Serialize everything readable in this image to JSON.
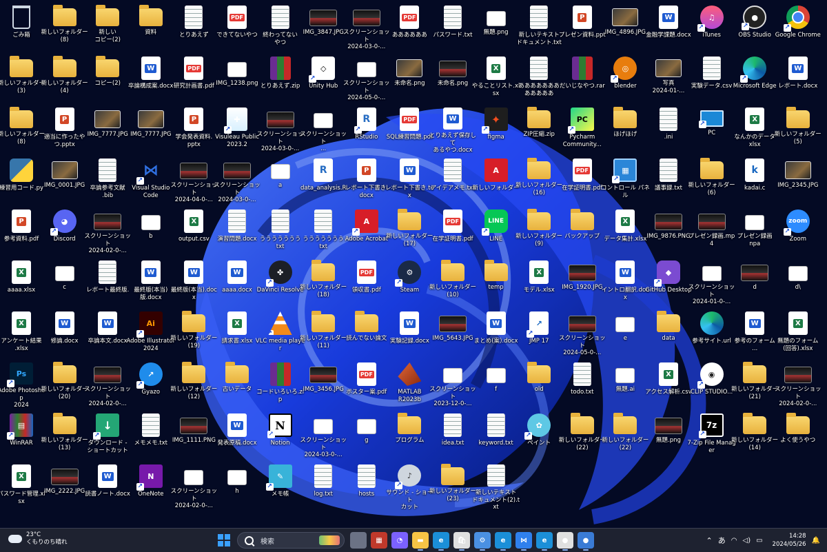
{
  "desktop": {
    "icons": [
      [
        "ごみ箱",
        "bin",
        "recycle-bin-icon",
        false
      ],
      [
        "新しいフォルダー\n(8)",
        "folder",
        "folder-icon",
        false
      ],
      [
        "新しい\nコピー(2)",
        "folder",
        "folder-icon",
        false
      ],
      [
        "資料",
        "folder",
        "folder-icon",
        false
      ],
      [
        "とりあえず",
        "txt",
        "text-file-icon",
        false
      ],
      [
        "できてないやつ",
        "pdf",
        "pdf-file-icon",
        false
      ],
      [
        "終わってない\nやつ",
        "txt",
        "text-file-icon",
        false
      ],
      [
        "IMG_3847.JPG",
        "shot",
        "image-file-icon",
        false
      ],
      [
        "スクリーンショット\n2024-03-0-...",
        "shot",
        "screenshot-file-icon",
        false
      ],
      [
        "ああああああ",
        "pdf",
        "pdf-file-icon",
        false
      ],
      [
        "パスワード.txt",
        "txt",
        "text-file-icon",
        false
      ],
      [
        "無題.png",
        "white",
        "image-file-icon",
        false
      ],
      [
        "新しいテキスト\nドキュメント.txt",
        "txt",
        "text-file-icon",
        false
      ],
      [
        "プレゼン資料.ppt",
        "ppt",
        "powerpoint-file-icon",
        false
      ],
      [
        "IMG_4896.JPG",
        "img",
        "image-file-icon",
        false
      ],
      [
        "金融学課題.docx",
        "word",
        "word-file-icon",
        false
      ],
      [
        "iTunes",
        "itunes",
        "itunes-icon",
        true
      ],
      [
        "OBS Studio",
        "obs",
        "obs-studio-icon",
        true
      ],
      [
        "Google Chrome",
        "chrome",
        "chrome-icon",
        true
      ],
      [
        "新しいフォルダー\n(3)",
        "folder",
        "folder-icon",
        false
      ],
      [
        "新しいフォルダー\n(4)",
        "folder",
        "folder-icon",
        false
      ],
      [
        "コピー(2)",
        "folder",
        "folder-icon",
        false
      ],
      [
        "卒論構成案.docx",
        "word",
        "word-file-icon",
        false
      ],
      [
        "研究計画書.pdf",
        "pdf",
        "pdf-file-icon",
        false
      ],
      [
        "IMG_1238.png",
        "white",
        "image-file-icon",
        false
      ],
      [
        "とりあえず.zip",
        "zip",
        "zip-file-icon",
        false
      ],
      [
        "Unity Hub",
        "unity",
        "unity-hub-icon",
        true
      ],
      [
        "スクリーンショット\n2024-05-0-...",
        "white",
        "screenshot-file-icon",
        false
      ],
      [
        "未命名.png",
        "img",
        "image-file-icon",
        false
      ],
      [
        "未命名.png",
        "shot",
        "image-file-icon",
        false
      ],
      [
        "やることリスト.xlsx",
        "excel",
        "excel-file-icon",
        false
      ],
      [
        "あああああああ\nあああああ",
        "txt",
        "text-file-icon",
        false
      ],
      [
        "だいじなやつ.rar",
        "zip",
        "rar-file-icon",
        false
      ],
      [
        "blender",
        "blender",
        "blender-icon",
        true
      ],
      [
        "写真\n2024-01-...",
        "img",
        "image-file-icon",
        false
      ],
      [
        "実験データ.csv",
        "txt",
        "csv-file-icon",
        false
      ],
      [
        "Microsoft Edge",
        "edge",
        "edge-icon",
        true
      ],
      [
        "レポート.docx",
        "word",
        "word-file-icon",
        false
      ],
      [
        "新しいフォルダー\n(8)",
        "folder",
        "folder-icon",
        false
      ],
      [
        "適当に作ったや\nつ.pptx",
        "ppt",
        "powerpoint-file-icon",
        false
      ],
      [
        "IMG_7777.JPG",
        "img",
        "image-file-icon",
        false
      ],
      [
        "IMG_7777.JPG",
        "img",
        "image-file-icon",
        false
      ],
      [
        "学会発表資料.\npptx",
        "ppt",
        "powerpoint-file-icon",
        false
      ],
      [
        "Visuleau Public\n2023.2",
        "visu",
        "tableau-public-icon",
        true
      ],
      [
        "スクリーンショット\n2024-03-0-...",
        "shot",
        "screenshot-file-icon",
        false
      ],
      [
        "スクリーンショット\n...",
        "white",
        "screenshot-file-icon",
        false
      ],
      [
        "RStudio",
        "r",
        "rstudio-icon",
        true
      ],
      [
        "SQL練習問題.pdf",
        "pdf",
        "pdf-file-icon",
        false
      ],
      [
        "とりあえず保存して\nあるやつ.docx",
        "word",
        "word-file-icon",
        false
      ],
      [
        "figma",
        "figma",
        "figma-icon",
        true
      ],
      [
        "ZIP圧縮.zip",
        "folder",
        "zip-folder-icon",
        false
      ],
      [
        "Pycharm\nCommunity...",
        "pyc",
        "pycharm-icon",
        true
      ],
      [
        "ほげほげ",
        "folder",
        "folder-icon",
        false
      ],
      [
        ".ini",
        "txt",
        "ini-file-icon",
        false
      ],
      [
        "PC",
        "pc",
        "pc-icon",
        true
      ],
      [
        "なんかのデータ\nxlsx",
        "excel",
        "excel-file-icon",
        false
      ],
      [
        "新しいフォルダー\n(5)",
        "folder",
        "folder-icon",
        false
      ],
      [
        "練習用コード.py",
        "py",
        "python-file-icon",
        false
      ],
      [
        "IMG_0001.JPG",
        "img",
        "image-file-icon",
        false
      ],
      [
        "卒論参考文献\n.bib",
        "txt",
        "bib-file-icon",
        false
      ],
      [
        "Visual Studio\nCode",
        "vs",
        "vscode-icon",
        true
      ],
      [
        "スクリーンショット\n2024-04-0-...",
        "shot",
        "screenshot-file-icon",
        false
      ],
      [
        "スクリーンショット\n2024-03-0-...",
        "shot",
        "screenshot-file-icon",
        false
      ],
      [
        "a",
        "white",
        "file-icon",
        false
      ],
      [
        "data_analysis.R",
        "r",
        "r-file-icon",
        false
      ],
      [
        "レポート下書き.\ndocx",
        "ppt",
        "word-file-icon",
        false
      ],
      [
        "レポート下書き.tex",
        "word",
        "tex-file-icon",
        false
      ],
      [
        "アイデアメモ.txt",
        "txt",
        "text-file-icon",
        false
      ],
      [
        "新しいフォルダー",
        "acrobat",
        "folder-icon",
        false
      ],
      [
        "新しいフォルダー\n(16)",
        "folder",
        "folder-icon",
        false
      ],
      [
        "在学証明書.pdf",
        "pdf",
        "pdf-file-icon",
        false
      ],
      [
        "コントロール パネル",
        "ctrl",
        "control-panel-icon",
        true
      ],
      [
        "議事録.txt",
        "txt",
        "text-file-icon",
        false
      ],
      [
        "新しいフォルダー\n(6)",
        "folder",
        "folder-icon",
        false
      ],
      [
        "kadai.c",
        "k",
        "c-file-icon",
        false
      ],
      [
        "IMG_2345.JPG",
        "img",
        "image-file-icon",
        false
      ],
      [
        "参考資料.pdf",
        "ppt",
        "pdf-file-icon",
        false
      ],
      [
        "Discord",
        "discord",
        "discord-icon",
        true
      ],
      [
        "スクリーンショット\n2024-02-0-...",
        "shot",
        "screenshot-file-icon",
        false
      ],
      [
        "b",
        "white",
        "file-icon",
        false
      ],
      [
        "output.csv",
        "excel",
        "csv-file-icon",
        false
      ],
      [
        "演習問題.docx",
        "txt",
        "word-file-icon",
        false
      ],
      [
        "ううううううう\ntxt",
        "txt",
        "text-file-icon",
        false
      ],
      [
        "ううううううう\ntxt",
        "txt",
        "text-file-icon",
        false
      ],
      [
        "Adobe Acrobat",
        "acrobat",
        "adobe-acrobat-icon",
        true
      ],
      [
        "新しいフォルダー\n(17)",
        "folder",
        "folder-icon",
        false
      ],
      [
        "在学証明書.pdf",
        "pdf",
        "pdf-file-icon",
        false
      ],
      [
        "LINE",
        "line",
        "line-icon",
        true
      ],
      [
        "新しいフォルダー\n(9)",
        "folder",
        "folder-icon",
        false
      ],
      [
        "バックアップ",
        "folder",
        "folder-icon",
        false
      ],
      [
        "データ集計.xlsx",
        "excel",
        "excel-file-icon",
        false
      ],
      [
        "IMG_9876.PNG",
        "shot",
        "image-file-icon",
        false
      ],
      [
        "プレゼン録画.mp4",
        "shot",
        "video-file-icon",
        false
      ],
      [
        "プレゼン録画\nnpa",
        "white",
        "file-icon",
        false
      ],
      [
        "Zoom",
        "zoom",
        "zoom-icon",
        true
      ],
      [
        "aaaa.xlsx",
        "excel",
        "excel-file-icon",
        false
      ],
      [
        "c",
        "white",
        "file-icon",
        false
      ],
      [
        "レポート最終版.",
        "txt",
        "text-file-icon",
        false
      ],
      [
        "最終版(本当)\n版.docx",
        "word",
        "word-file-icon",
        false
      ],
      [
        "最終版(本当).docx",
        "word",
        "word-file-icon",
        false
      ],
      [
        "aaaa.docx",
        "word",
        "word-file-icon",
        false
      ],
      [
        "DaVinci Resolve",
        "davinci",
        "davinci-resolve-icon",
        true
      ],
      [
        "新しいフォルダー\n(18)",
        "folder",
        "folder-icon",
        false
      ],
      [
        "領収書.pdf",
        "pdf",
        "pdf-file-icon",
        false
      ],
      [
        "Steam",
        "steam",
        "steam-icon",
        true
      ],
      [
        "新しいフォルダー\n(10)",
        "folder",
        "folder-icon",
        false
      ],
      [
        "temp",
        "folder",
        "folder-icon",
        false
      ],
      [
        "モデル.xlsx",
        "excel",
        "excel-file-icon",
        false
      ],
      [
        "IMG_1920.JPG",
        "shot",
        "image-file-icon",
        false
      ],
      [
        "イントロ翻訳.docx",
        "word",
        "word-file-icon",
        false
      ],
      [
        "GitHub Desktop",
        "gh",
        "github-desktop-icon",
        true
      ],
      [
        "スクリーンショット\n2024-01-0-...",
        "white",
        "screenshot-file-icon",
        false
      ],
      [
        "d",
        "shot",
        "file-icon",
        false
      ],
      [
        "d\\",
        "white",
        "file-icon",
        false
      ],
      [
        "アンケート結果\n.xlsx",
        "excel",
        "excel-file-icon",
        false
      ],
      [
        "修論.docx",
        "word",
        "word-file-icon",
        false
      ],
      [
        "卒論本文.docx",
        "word",
        "word-file-icon",
        false
      ],
      [
        "Adobe Illustrator\n2024",
        "ai",
        "illustrator-icon",
        true
      ],
      [
        "新しいフォルダー\n(19)",
        "folder",
        "folder-icon",
        false
      ],
      [
        "請求書.xlsx",
        "excel",
        "excel-file-icon",
        false
      ],
      [
        "VLC media player",
        "vlc",
        "vlc-icon",
        true
      ],
      [
        "新しいフォルダー\n(11)",
        "folder",
        "folder-icon",
        false
      ],
      [
        "読んでない論文",
        "folder",
        "folder-icon",
        false
      ],
      [
        "実験記録.docx",
        "word",
        "word-file-icon",
        false
      ],
      [
        "IMG_5643.JPG",
        "shot",
        "image-file-icon",
        false
      ],
      [
        "まとめ(案).docx",
        "word",
        "word-file-icon",
        false
      ],
      [
        "JMP 17",
        "jmp",
        "jmp-icon",
        true
      ],
      [
        "スクリーンショット\n2024-05-0-...",
        "shot",
        "screenshot-file-icon",
        false
      ],
      [
        "e",
        "white",
        "file-icon",
        false
      ],
      [
        "data",
        "folder",
        "folder-icon",
        false
      ],
      [
        "参考サイト.url",
        "edge",
        "url-file-icon",
        false
      ],
      [
        "参考のフォーム\n...",
        "word",
        "word-file-icon",
        false
      ],
      [
        "無題のフォーム\n(回答).xlsx",
        "excel",
        "excel-file-icon",
        false
      ],
      [
        "Adobe Photoshop\n2024",
        "ps",
        "photoshop-icon",
        true
      ],
      [
        "新しいフォルダー\n(20)",
        "folder",
        "folder-icon",
        false
      ],
      [
        "スクリーンショット\n2024-02-0-...",
        "shot",
        "screenshot-file-icon",
        false
      ],
      [
        "Gyazo",
        "gyazo",
        "gyazo-icon",
        true
      ],
      [
        "新しいフォルダー\n(12)",
        "folder",
        "folder-icon",
        false
      ],
      [
        "古いデータ",
        "folder",
        "folder-icon",
        false
      ],
      [
        "コードいろいろ.zip",
        "zip",
        "zip-file-icon",
        false
      ],
      [
        "IMG_3456.JPG",
        "shot",
        "image-file-icon",
        false
      ],
      [
        "ポスター案.pdf",
        "pdf",
        "pdf-file-icon",
        false
      ],
      [
        "MATLAB\nR2023b",
        "matlab",
        "matlab-icon",
        true
      ],
      [
        "スクリーンショット\n2023-12-0-...",
        "white",
        "screenshot-file-icon",
        false
      ],
      [
        "f",
        "white",
        "file-icon",
        false
      ],
      [
        "old",
        "folder",
        "folder-icon",
        false
      ],
      [
        "todo.txt",
        "txt",
        "text-file-icon",
        false
      ],
      [
        "無題.ai",
        "white",
        "illustrator-file-icon",
        false
      ],
      [
        "アクセス解析.csv",
        "excel",
        "csv-file-icon",
        false
      ],
      [
        "CLIP STUDIO...",
        "clip",
        "clip-studio-icon",
        true
      ],
      [
        "新しいフォルダー\n(21)",
        "folder",
        "folder-icon",
        false
      ],
      [
        "スクリーンショット\n2024-02-0-...",
        "shot",
        "screenshot-file-icon",
        false
      ],
      [
        "WinRAR",
        "winrar",
        "winrar-icon",
        true
      ],
      [
        "新しいフォルダー\n(13)",
        "folder",
        "folder-icon",
        false
      ],
      [
        "ダウンロード -\nショートカット",
        "dl",
        "download-shortcut-icon",
        true
      ],
      [
        "メモメモ.txt",
        "txt",
        "text-file-icon",
        false
      ],
      [
        "IMG_1111.PNG",
        "shot",
        "image-file-icon",
        false
      ],
      [
        "発表原稿.docx",
        "word",
        "word-file-icon",
        false
      ],
      [
        "Notion",
        "notion",
        "notion-icon",
        true
      ],
      [
        "スクリーンショット\n2024-03-0-...",
        "white",
        "screenshot-file-icon",
        false
      ],
      [
        "g",
        "white",
        "file-icon",
        false
      ],
      [
        "プログラム",
        "folder",
        "folder-icon",
        false
      ],
      [
        "idea.txt",
        "txt",
        "text-file-icon",
        false
      ],
      [
        "keyword.txt",
        "txt",
        "text-file-icon",
        false
      ],
      [
        "ペイント",
        "paint",
        "paint-icon",
        true
      ],
      [
        "新しいフォルダー\n(22)",
        "folder",
        "folder-icon",
        false
      ],
      [
        "新しいフォルダー\n(22)",
        "folder",
        "folder-icon",
        false
      ],
      [
        "無題.png",
        "shot",
        "image-file-icon",
        false
      ],
      [
        "7-Zip File Manager",
        "7z",
        "7zip-icon",
        true
      ],
      [
        "新しいフォルダー\n(14)",
        "folder",
        "folder-icon",
        false
      ],
      [
        "よく使うやつ",
        "folder",
        "folder-icon",
        false
      ],
      [
        "パスワード管理.xlsx",
        "excel",
        "excel-file-icon",
        false
      ],
      [
        "IMG_2222.JPG",
        "shot",
        "image-file-icon",
        false
      ],
      [
        "読書ノート.docx",
        "word",
        "word-file-icon",
        false
      ],
      [
        "OneNote",
        "onenote",
        "onenote-icon",
        true
      ],
      [
        "スクリーンショット\n2024-02-0-...",
        "white",
        "screenshot-file-icon",
        false
      ],
      [
        "h",
        "white",
        "file-icon",
        false
      ],
      [
        "メモ帳",
        "memo",
        "notepad-icon",
        true
      ],
      [
        "log.txt",
        "txt",
        "text-file-icon",
        false
      ],
      [
        "hosts",
        "txt",
        "hosts-file-icon",
        false
      ],
      [
        "サウンド - ショート\nカット",
        "sound",
        "sound-shortcut-icon",
        true
      ],
      [
        "新しいフォルダー\n(23)",
        "folder",
        "folder-icon",
        false
      ],
      [
        "新しいテキスト\nドキュメント(2).txt",
        "txt",
        "text-file-icon",
        false
      ]
    ],
    "glyph_text": {
      "pdf": "PDF",
      "word": "W",
      "excel": "X",
      "ppt": "P",
      "k": "k",
      "r": "R",
      "jmp": "↗",
      "notion": "N",
      "onenote": "N",
      "figma": "✦",
      "pyc": "PC",
      "acrobat": "A",
      "ai": "Ai",
      "ps": "Ps",
      "clip": "◉",
      "gh": "◆",
      "discord": "◕",
      "zoom": "zoom",
      "line": "LINE",
      "steam": "⚙",
      "7z": "7z",
      "dl": "↓",
      "unity": "◇",
      "vs": "⋈",
      "memo": "✎",
      "sound": "♪",
      "itunes": "♫",
      "obs": "●",
      "blender": "◎",
      "davinci": "✤",
      "gyazo": "↗",
      "matlab": "",
      "paint": "✿",
      "visu": "✚",
      "py": "",
      "winrar": "▤",
      "ctrl": "▦",
      "pc": "",
      "edge": "",
      "chrome": "",
      "bin": "",
      "vlc": ""
    }
  },
  "taskbar": {
    "weather_temp": "23°C",
    "weather_desc": "くもりのち晴れ",
    "search_placeholder": "検索",
    "ime": "あ",
    "time": "14:28",
    "date": "2024/05/26",
    "apps": [
      [
        "task-view-icon",
        "#6b7285",
        ""
      ],
      [
        "widget-icon",
        "#c0392b",
        "▦"
      ],
      [
        "chat-icon",
        "#7b61ff",
        "◔"
      ],
      [
        "file-explorer-icon",
        "#f6c445",
        "▬"
      ],
      [
        "edge-icon",
        "#1b8fd8",
        "e"
      ],
      [
        "store-icon",
        "#e0e0e0",
        "🛍"
      ],
      [
        "settings-icon",
        "#4a90e2",
        "⚙"
      ],
      [
        "edge-icon-2",
        "#1b8fd8",
        "e"
      ],
      [
        "vscode-icon",
        "#2f80ed",
        "⋈"
      ],
      [
        "edge-dev-icon",
        "#1b8fd8",
        "e"
      ],
      [
        "chrome-icon",
        "#e0e0e0",
        "●"
      ],
      [
        "chrome-alt-icon",
        "#3a7bd5",
        "●"
      ]
    ],
    "colors": {
      "accent": "#3aa0ff",
      "taskbar": "#1e2230"
    }
  }
}
